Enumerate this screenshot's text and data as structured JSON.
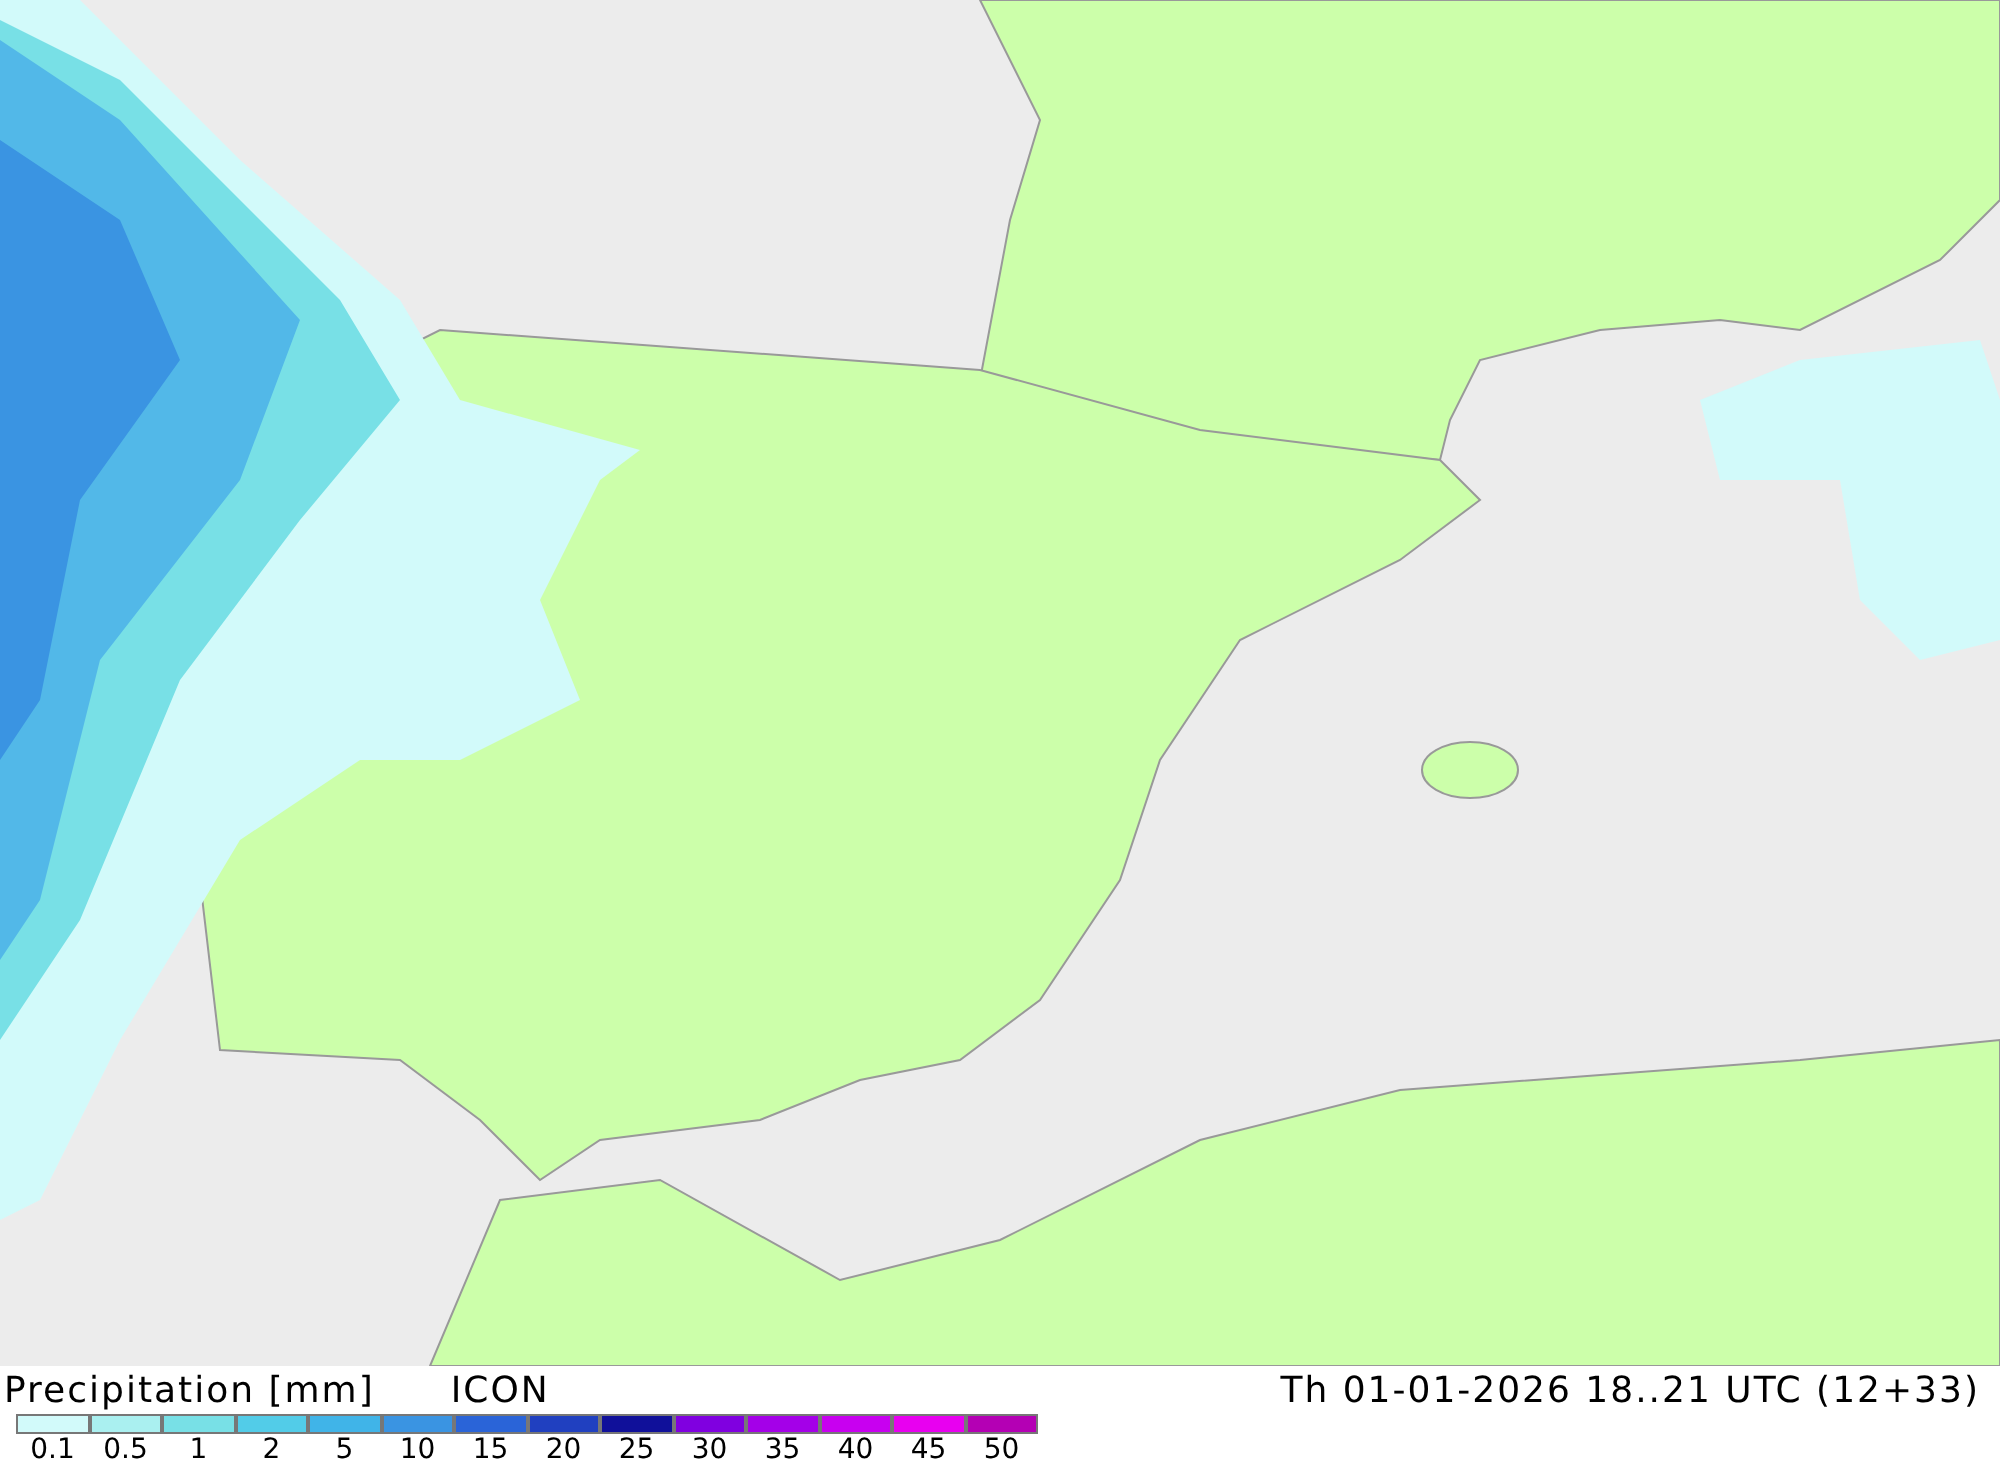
{
  "header": {
    "label": "Precipitation [mm]",
    "model": "ICON",
    "valid_time": "Th 01-01-2026 18..21 UTC (12+33)"
  },
  "legend": [
    {
      "label": "0.1",
      "color": "#d2fafa"
    },
    {
      "label": "0.5",
      "color": "#aaf0f0"
    },
    {
      "label": "1",
      "color": "#78e0e6"
    },
    {
      "label": "2",
      "color": "#52cce8"
    },
    {
      "label": "5",
      "color": "#40b4e8"
    },
    {
      "label": "10",
      "color": "#3a94e2"
    },
    {
      "label": "15",
      "color": "#2a64d8"
    },
    {
      "label": "20",
      "color": "#2040c0"
    },
    {
      "label": "25",
      "color": "#10109a"
    },
    {
      "label": "30",
      "color": "#8000e0"
    },
    {
      "label": "35",
      "color": "#a400e8"
    },
    {
      "label": "40",
      "color": "#c800f0"
    },
    {
      "label": "45",
      "color": "#e800f0"
    },
    {
      "label": "50",
      "color": "#b400b4"
    }
  ]
}
